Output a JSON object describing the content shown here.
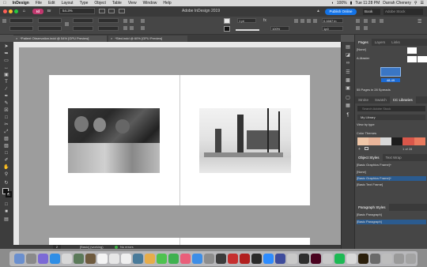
{
  "menubar": {
    "app": "InDesign",
    "items": [
      "File",
      "Edit",
      "Layout",
      "Type",
      "Object",
      "Table",
      "View",
      "Window",
      "Help"
    ],
    "battery": "100%",
    "time": "Tue 11:28 PM",
    "user": "Darrah Chenery"
  },
  "titlebar": {
    "title": "Adobe InDesign 2019",
    "publish": "Publish Online",
    "workspace": "Book",
    "search_placeholder": "Adobe Stock"
  },
  "control": {
    "zoom": "54.3%",
    "stroke_weight": "1 pt",
    "opacity": "100%",
    "ref": "0.1667 in",
    "size": "1p0"
  },
  "tabs": [
    "*Patient Observation.indd @ 54% [GPU Preview]",
    "*Sled.indd @ 60% [GPU Preview]"
  ],
  "status": {
    "page": "2",
    "mode": "[Basic] (working)",
    "errors": "No errors"
  },
  "pages_panel": {
    "tabs": [
      "Pages",
      "Layers",
      "Links"
    ],
    "none": "[None]",
    "master": "A-Master",
    "spread_label": "48-49",
    "footer": "55 Pages in 28 Spreads"
  },
  "library_panel": {
    "tabs": [
      "Stroke",
      "Swatch",
      "CC Libraries"
    ],
    "search_placeholder": "Search Adobe Stock",
    "library": "My Library",
    "view": "View by type",
    "colors_heading": "Color Themes",
    "swatch_label": "1 of 28"
  },
  "object_styles": {
    "tabs": [
      "Object Styles",
      "Text Wrap"
    ],
    "current": "[Basic Graphics Frame]+",
    "items": [
      "[None]",
      "[Basic Graphics Frame]+",
      "[Basic Text Frame]"
    ]
  },
  "paragraph_styles": {
    "tabs": [
      "Paragraph Styles"
    ],
    "current": "[Basic Paragraph]",
    "items": [
      "[Basic Paragraph]"
    ]
  },
  "colors": {
    "accent": "#1473e6",
    "swatches": [
      "#f0c7a8",
      "#e9b59a",
      "#d8d8d8",
      "#1d1d1d",
      "#d9574a",
      "#e97a5e"
    ]
  }
}
